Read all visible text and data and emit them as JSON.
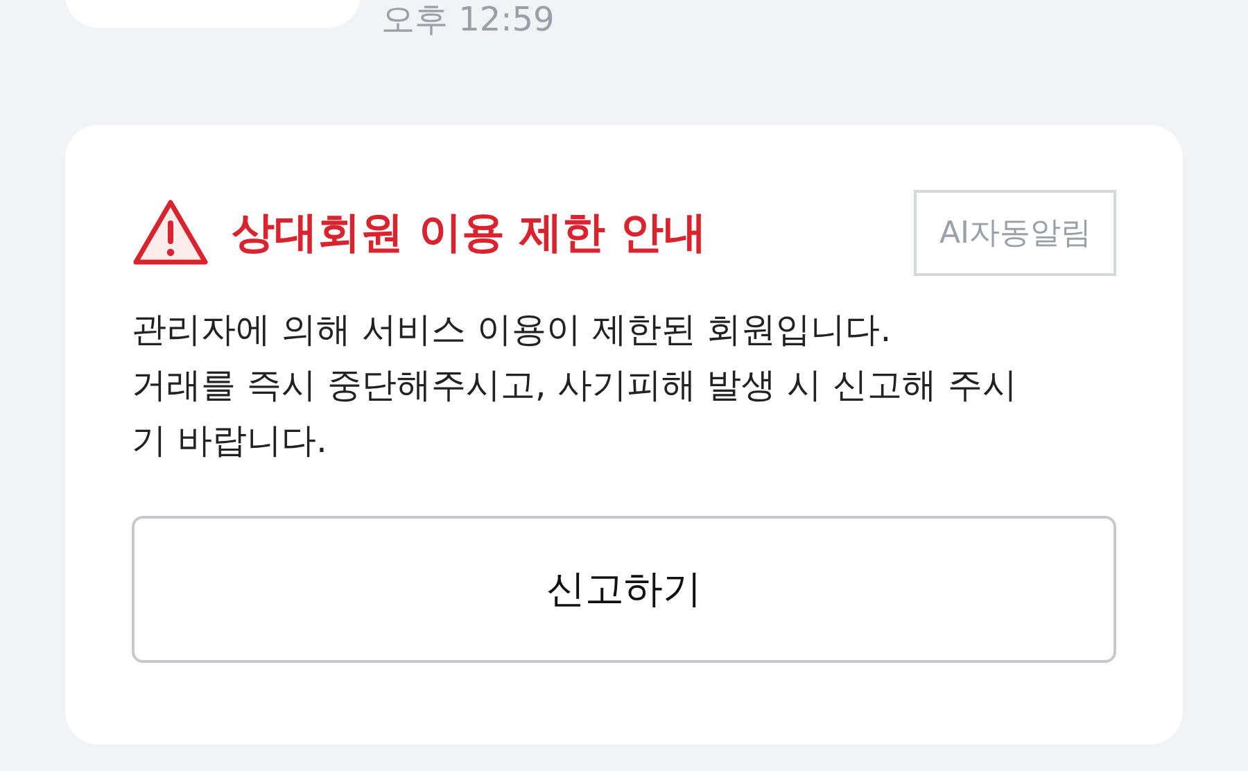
{
  "previous_message": {
    "time": "오후 12:59"
  },
  "notice": {
    "title": "상대회원 이용 제한 안내",
    "badge": "AI자동알림",
    "body_lines": [
      "관리자에 의해 서비스 이용이 제한된 회원입니다.",
      "거래를 즉시 중단해주시고, 사기피해 발생 시 신고해 주시",
      "기 바랍니다."
    ],
    "button": "신고하기"
  }
}
